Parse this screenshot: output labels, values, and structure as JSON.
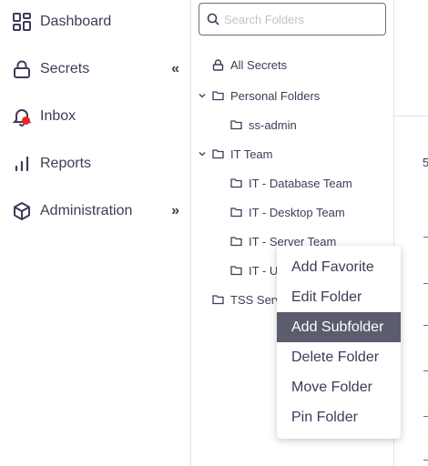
{
  "nav": {
    "items": [
      {
        "label": "Dashboard",
        "icon": "dashboard-icon"
      },
      {
        "label": "Secrets",
        "icon": "lock-icon",
        "toggle": "«"
      },
      {
        "label": "Inbox",
        "icon": "bell-icon"
      },
      {
        "label": "Reports",
        "icon": "bar-chart-icon"
      },
      {
        "label": "Administration",
        "icon": "cube-icon",
        "toggle": "»"
      }
    ],
    "notification_color": "#e8272c"
  },
  "folders": {
    "search_placeholder": "Search Folders",
    "tree": [
      {
        "label": "All Secrets",
        "icon": "lock-icon"
      },
      {
        "label": "Personal Folders",
        "icon": "folder-icon",
        "expanded": true
      },
      {
        "label": "ss-admin",
        "icon": "folder-icon"
      },
      {
        "label": "IT Team",
        "icon": "folder-icon",
        "expanded": true
      },
      {
        "label": "IT - Database Team",
        "icon": "folder-icon"
      },
      {
        "label": "IT - Desktop Team",
        "icon": "folder-icon"
      },
      {
        "label": "IT - Server Team",
        "icon": "folder-icon"
      },
      {
        "label": "IT - U",
        "icon": "folder-icon"
      },
      {
        "label": "TSS Serv",
        "icon": "folder-icon"
      }
    ]
  },
  "content": {
    "partial_number": "5"
  },
  "context_menu": {
    "items": [
      {
        "label": "Add Favorite",
        "active": false
      },
      {
        "label": "Edit Folder",
        "active": false
      },
      {
        "label": "Add Subfolder",
        "active": true
      },
      {
        "label": "Delete Folder",
        "active": false
      },
      {
        "label": "Move Folder",
        "active": false
      },
      {
        "label": "Pin Folder",
        "active": false
      }
    ],
    "highlight_color": "#5b5c6e"
  }
}
